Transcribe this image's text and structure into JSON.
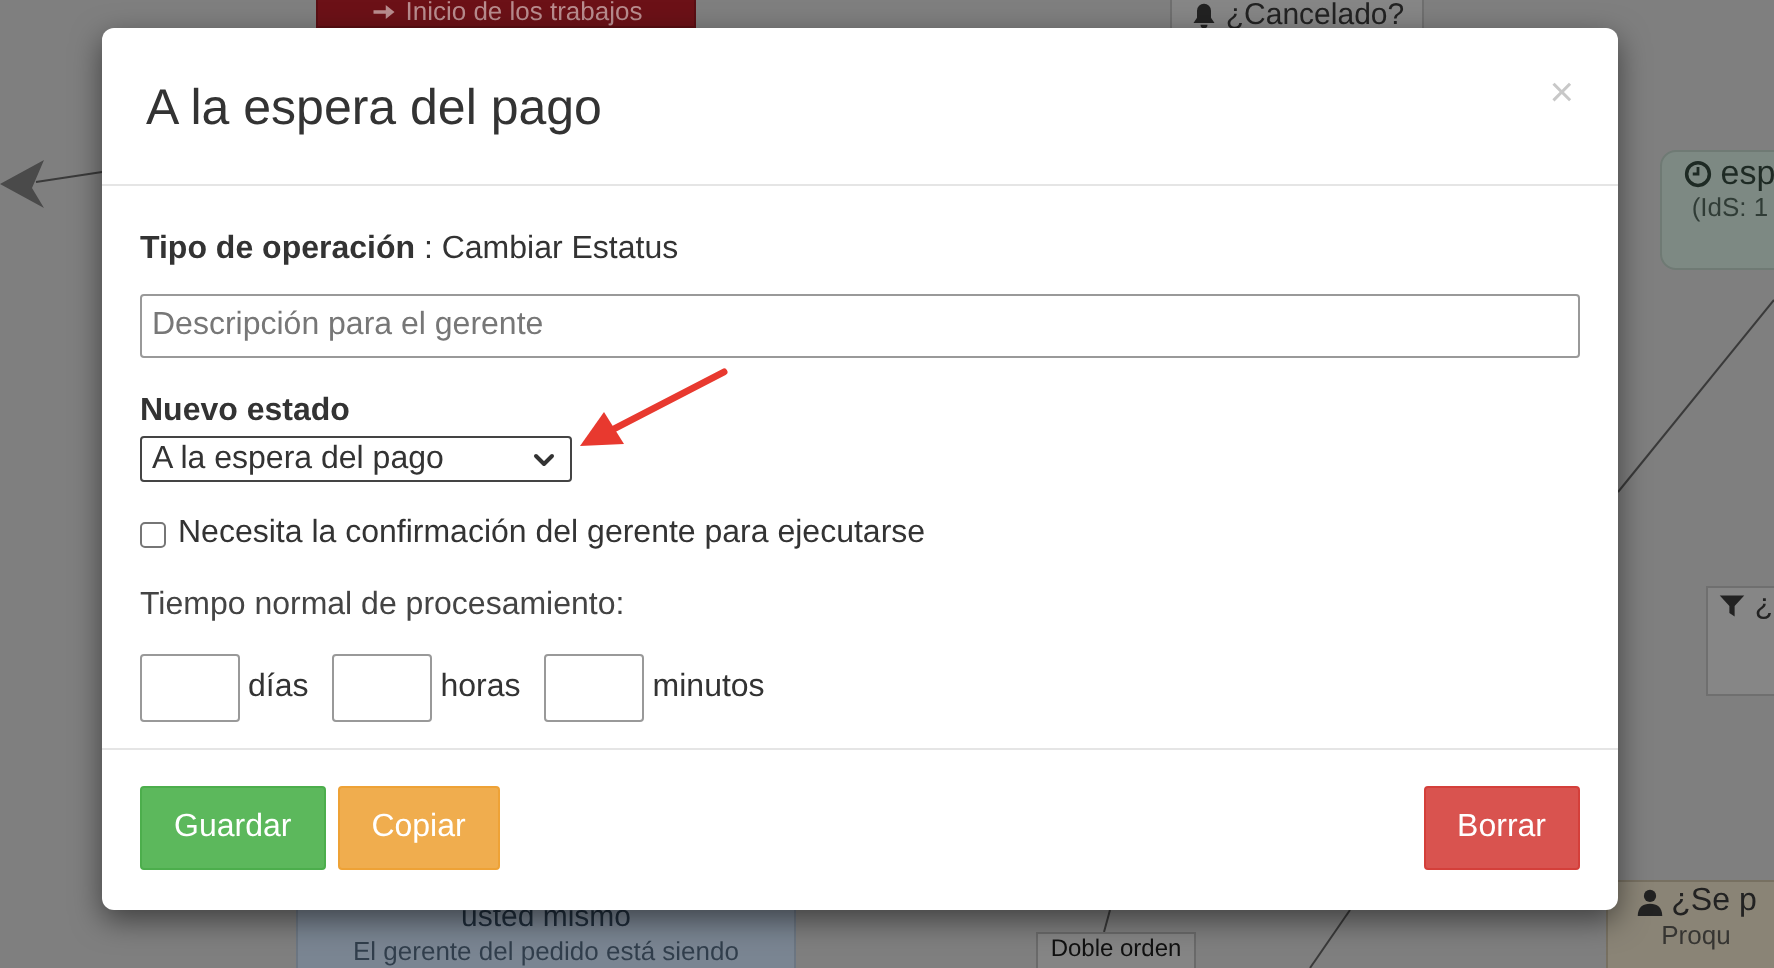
{
  "background": {
    "nodes": [
      {
        "kind": "start",
        "lines": [
          "Inicio de los trabajos"
        ]
      },
      {
        "kind": "plain",
        "lines": [
          "¿Cancelado?"
        ]
      },
      {
        "kind": "status",
        "lines": [
          "esp",
          "(IdS: 1"
        ]
      },
      {
        "kind": "plain",
        "lines": [
          "¿"
        ]
      },
      {
        "kind": "info",
        "lines": [
          "usted mismo",
          "El gerente del pedido está siendo"
        ]
      },
      {
        "kind": "tag",
        "lines": [
          "Doble orden"
        ]
      },
      {
        "kind": "question",
        "lines": [
          "¿Se p",
          "Proqu"
        ]
      }
    ]
  },
  "modal": {
    "title": "A la espera del pago",
    "close": "×",
    "operation_label": "Tipo de operación",
    "operation_value": " : Cambiar Estatus",
    "description": {
      "placeholder": "Descripción para el gerente"
    },
    "state_label": "Nuevo estado",
    "state_value": "A la espera del pago",
    "confirm": {
      "label": "Necesita la confirmación del gerente para ejecutarse",
      "checked": false
    },
    "time_label": "Tiempo normal de procesamiento:",
    "time_fields": [
      {
        "unit": "días"
      },
      {
        "unit": "horas"
      },
      {
        "unit": "minutos"
      }
    ],
    "buttons": [
      {
        "label": "Guardar",
        "kind": "success"
      },
      {
        "label": "Copiar",
        "kind": "warning"
      },
      {
        "label": "Borrar",
        "kind": "danger"
      }
    ]
  }
}
